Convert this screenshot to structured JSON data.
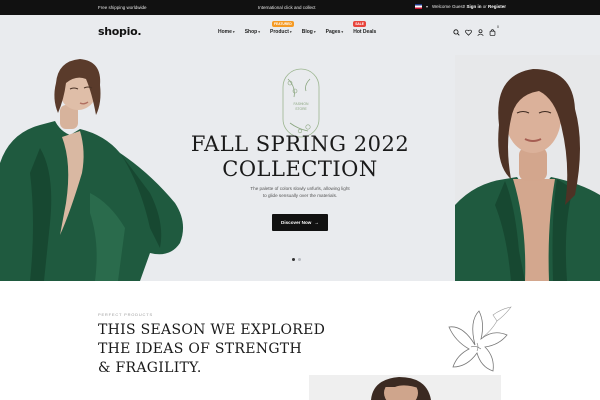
{
  "topbar": {
    "left_text": "Free shipping worldwide",
    "center_text": "International click and collect",
    "welcome_text": "Welcome Guest!",
    "sign_in": "Sign in",
    "or": "or",
    "register": "Register"
  },
  "header": {
    "logo": "shopio.",
    "nav": [
      {
        "label": "Home",
        "badge": ""
      },
      {
        "label": "Shop",
        "badge": ""
      },
      {
        "label": "Product",
        "badge": "FEATURED"
      },
      {
        "label": "Blog",
        "badge": ""
      },
      {
        "label": "Pages",
        "badge": ""
      },
      {
        "label": "Hot Deals",
        "badge": "SALE"
      }
    ],
    "cart_count": "0"
  },
  "hero": {
    "emblem_text_1": "FASHION",
    "emblem_text_2": "STORE",
    "title_line1": "FALL SPRING 2022",
    "title_line2": "COLLECTION",
    "subtitle_line1": "The palette of colors slowly unfurls, allowing light",
    "subtitle_line2": "to glide sensually over the materials.",
    "cta_label": "Discover Now",
    "slide_count": 2,
    "active_slide": 1
  },
  "section": {
    "label": "PERFECT PRODUCTS",
    "title_line1": "THIS SEASON WE EXPLORED",
    "title_line2": "THE IDEAS OF STRENGTH",
    "title_line3": "& FRAGILITY."
  },
  "colors": {
    "topbar": "#111111",
    "hero_bg": "#e9ebee",
    "dress_green": "#1f5a3f",
    "button": "#111111",
    "badge_orange": "#f59a23",
    "badge_red": "#e8453c"
  }
}
